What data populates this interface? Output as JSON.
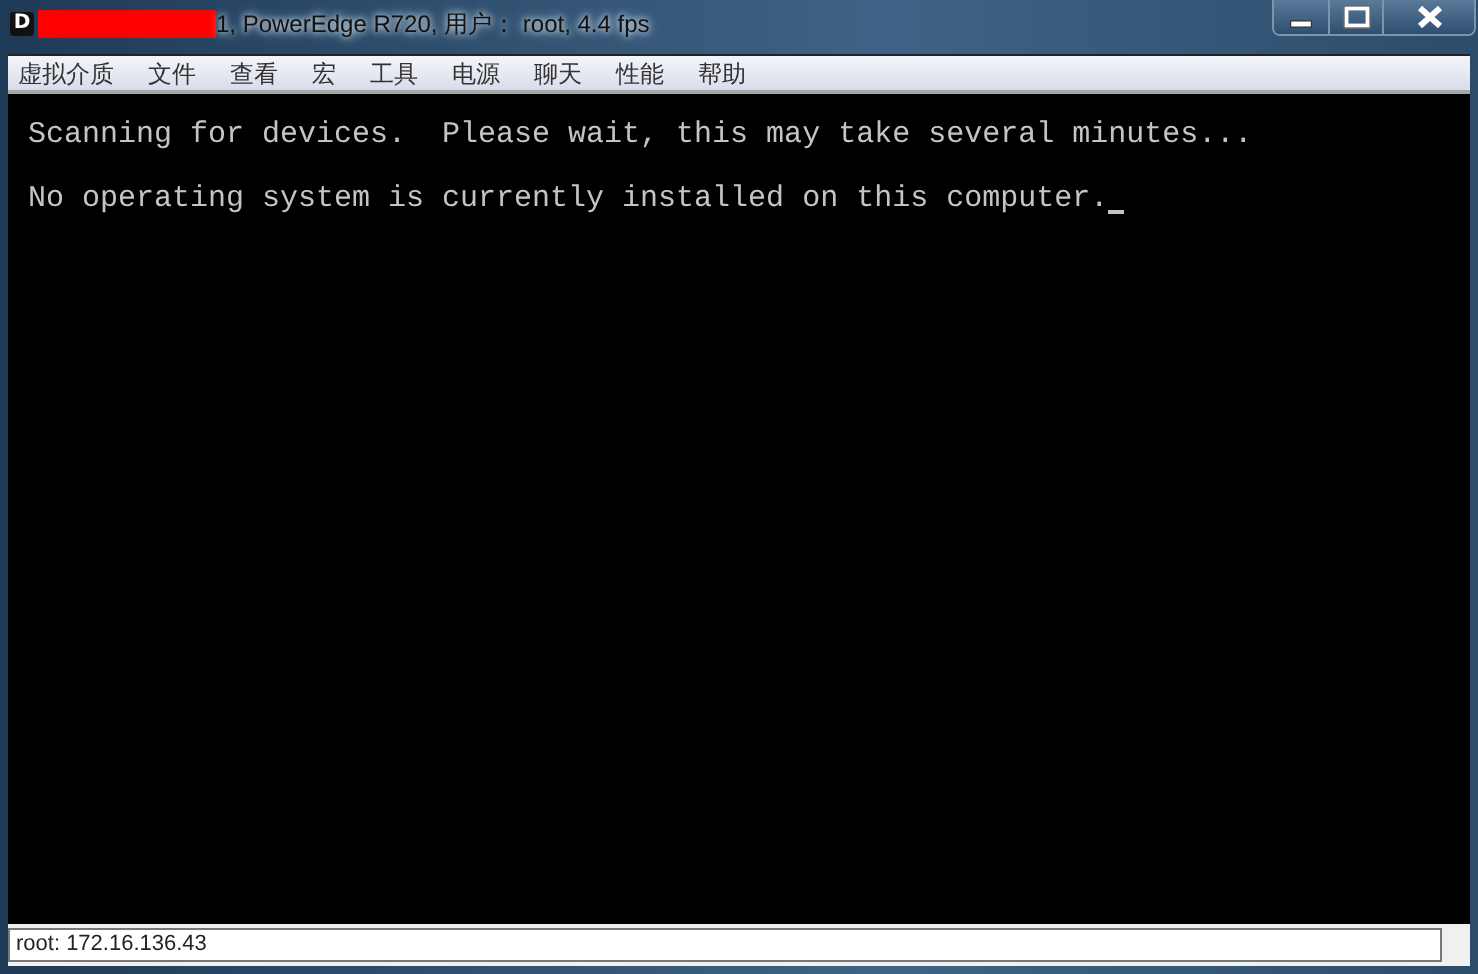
{
  "window": {
    "icon_letter": "D",
    "title_redacted": true,
    "title": "1, PowerEdge R720, 用户： root, 4.4 fps",
    "controls": [
      {
        "kind": "minimize"
      },
      {
        "kind": "maximize"
      },
      {
        "kind": "close"
      }
    ]
  },
  "menu": [
    "虚拟介质",
    "文件",
    "查看",
    "宏",
    "工具",
    "电源",
    "聊天",
    "性能",
    "帮助"
  ],
  "console": {
    "lines": [
      "Scanning for devices.  Please wait, this may take several minutes...",
      "No operating system is currently installed on this computer."
    ],
    "cursor": true
  },
  "status_bar": {
    "text": "root: 172.16.136.43"
  }
}
